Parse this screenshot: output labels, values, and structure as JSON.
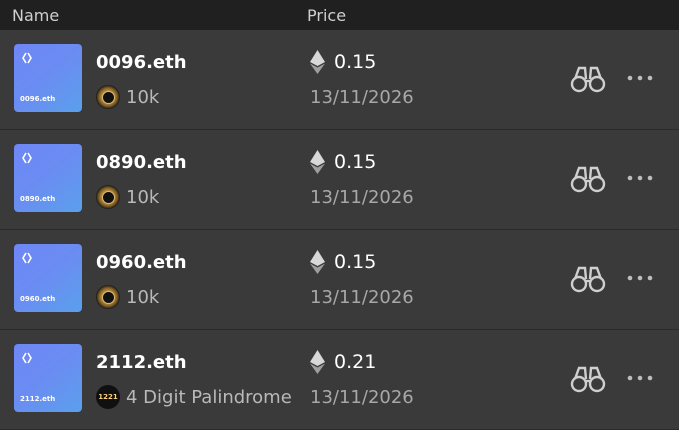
{
  "header": {
    "name_label": "Name",
    "price_label": "Price"
  },
  "rows": [
    {
      "domain": "0096.eth",
      "thumb_label": "0096.eth",
      "tag": "10k",
      "tag_icon": "10k-club-badge",
      "price": "0.15",
      "date": "13/11/2026"
    },
    {
      "domain": "0890.eth",
      "thumb_label": "0890.eth",
      "tag": "10k",
      "tag_icon": "10k-club-badge",
      "price": "0.15",
      "date": "13/11/2026"
    },
    {
      "domain": "0960.eth",
      "thumb_label": "0960.eth",
      "tag": "10k",
      "tag_icon": "10k-club-badge",
      "price": "0.15",
      "date": "13/11/2026"
    },
    {
      "domain": "2112.eth",
      "thumb_label": "2112.eth",
      "tag": "4 Digit Palindrome",
      "tag_icon": "palindrome-badge",
      "tag_badge_text": "1221",
      "price": "0.21",
      "date": "13/11/2026"
    }
  ],
  "colors": {
    "accent_thumb_from": "#6f86f5",
    "accent_thumb_to": "#5aa0ec",
    "background": "#3a3a3a",
    "header_bg": "#202020"
  },
  "icons": {
    "currency": "ethereum-icon",
    "watch": "binoculars-icon",
    "menu": "more-horizontal-icon"
  }
}
